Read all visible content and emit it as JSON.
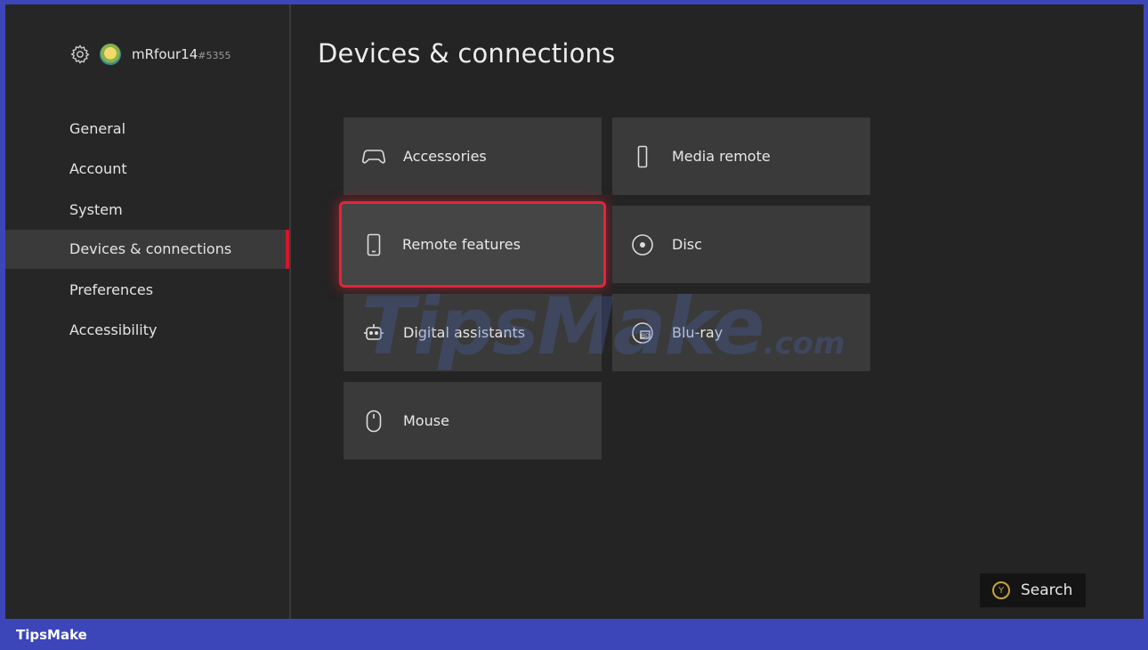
{
  "profile": {
    "gamertag": "mRfour14",
    "gamertag_suffix": "#5355"
  },
  "sidebar": {
    "items": [
      {
        "label": "General"
      },
      {
        "label": "Account"
      },
      {
        "label": "System"
      },
      {
        "label": "Devices & connections",
        "active": true
      },
      {
        "label": "Preferences"
      },
      {
        "label": "Accessibility"
      }
    ]
  },
  "main": {
    "title": "Devices & connections",
    "tiles": [
      {
        "label": "Accessories",
        "icon": "gamepad-icon"
      },
      {
        "label": "Media remote",
        "icon": "remote-icon"
      },
      {
        "label": "Remote features",
        "icon": "phone-icon",
        "focused": true
      },
      {
        "label": "Disc",
        "icon": "disc-icon"
      },
      {
        "label": "Digital assistants",
        "icon": "assistant-icon"
      },
      {
        "label": "Blu-ray",
        "icon": "bluray-icon"
      },
      {
        "label": "Mouse",
        "icon": "mouse-icon"
      }
    ]
  },
  "search_button": {
    "label": "Search",
    "button_glyph": "Y"
  },
  "watermark": {
    "text": "TipsMake",
    "suffix": ".com"
  },
  "footer": {
    "brand": "TipsMake"
  },
  "colors": {
    "accent": "#e0263a",
    "frame_border": "#3c46b8",
    "y_button": "#c8a23a"
  }
}
